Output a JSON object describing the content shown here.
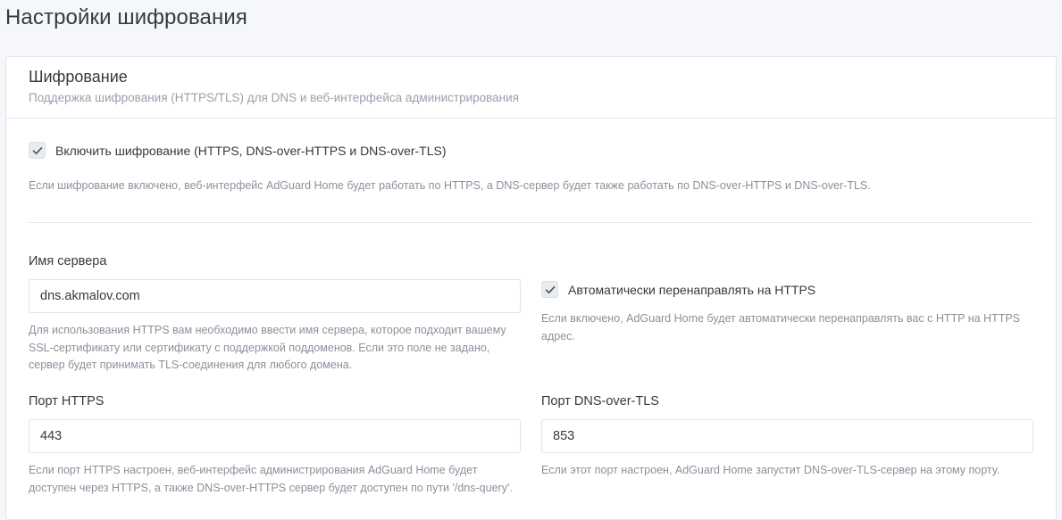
{
  "page": {
    "title": "Настройки шифрования"
  },
  "encryption_card": {
    "title": "Шифрование",
    "subtitle": "Поддержка шифрования (HTTPS/TLS) для DNS и веб-интерфейса администрирования",
    "enable": {
      "checked": true,
      "label": "Включить шифрование (HTTPS, DNS-over-HTTPS и DNS-over-TLS)",
      "help": "Если шифрование включено, веб-интерфейс AdGuard Home будет работать по HTTPS, а DNS-сервер будет также работать по DNS-over-HTTPS и DNS-over-TLS."
    },
    "server_name": {
      "label": "Имя сервера",
      "value": "dns.akmalov.com",
      "help_line1": "Для использования HTTPS вам необходимо ввести имя сервера, которое подходит вашему",
      "help_line2": "SSL-сертификату или сертификату с поддержкой поддоменов. Если это поле не задано,",
      "help_line3": "сервер будет принимать TLS-соединения для любого домена."
    },
    "force_https": {
      "checked": true,
      "label": "Автоматически перенаправлять на HTTPS",
      "help_line1": "Если включено, AdGuard Home будет автоматически перенаправлять вас с HTTP на HTTPS",
      "help_line2": "адрес."
    },
    "port_https": {
      "label": "Порт HTTPS",
      "value": "443",
      "help_line1": "Если порт HTTPS настроен, веб-интерфейс администрирования AdGuard Home будет",
      "help_line2": "доступен через HTTPS, а также DNS-over-HTTPS сервер будет доступен по пути '/dns-query'."
    },
    "port_dns_over_tls": {
      "label": "Порт DNS-over-TLS",
      "value": "853",
      "help": "Если этот порт настроен, AdGuard Home запустит DNS-over-TLS-сервер на этому порту."
    }
  },
  "colors": {
    "background": "#f5f7fb",
    "card": "#ffffff",
    "border": "#e0e5ec",
    "checkbox_fill": "#e9ecef",
    "check_mark": "#495057"
  }
}
